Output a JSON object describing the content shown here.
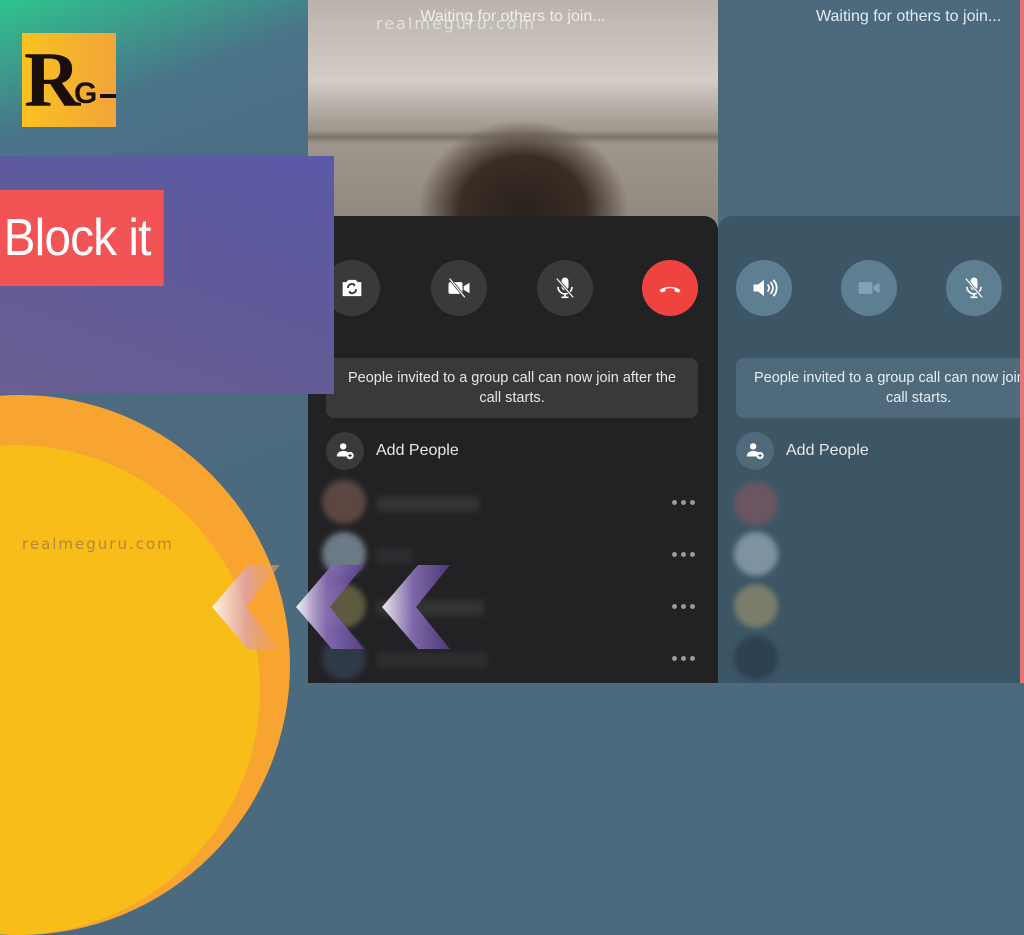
{
  "branding": {
    "logo_letters": {
      "main": "R",
      "sub": "G"
    },
    "watermark": "realmeguru.com",
    "headline": "Block it",
    "colors": {
      "headline_bg": "#f25456",
      "banner": "#5f5a9a",
      "logo_bg": "#f8c21f",
      "circle": "#f7a431"
    }
  },
  "call_screen_dark": {
    "status": "Waiting for others to join...",
    "controls": [
      {
        "id": "flip-camera",
        "icon": "camera-flip-icon"
      },
      {
        "id": "video-off",
        "icon": "video-off-icon"
      },
      {
        "id": "mute",
        "icon": "mic-off-icon"
      },
      {
        "id": "end-call",
        "icon": "phone-hangup-icon",
        "color": "#ef4340"
      }
    ],
    "notice": "People invited to a group call can now join after the call starts.",
    "add_people_label": "Add People",
    "participants": [
      {
        "avatar_color": "#5b4642",
        "more": "more-icon"
      },
      {
        "avatar_color": "#6c7a86",
        "more": "more-icon"
      },
      {
        "avatar_color": "#5d5a40",
        "more": "more-icon"
      },
      {
        "avatar_color": "#2f3a48",
        "more": "more-icon"
      }
    ]
  },
  "call_screen_light": {
    "status": "Waiting for others to join...",
    "controls": [
      {
        "id": "speaker",
        "icon": "speaker-icon"
      },
      {
        "id": "video",
        "icon": "video-icon"
      },
      {
        "id": "mute",
        "icon": "mic-off-icon"
      }
    ],
    "notice_line1": "People invited to a group call can now join after the",
    "notice_line2": "call starts.",
    "add_people_label": "Add People",
    "participants": [
      {
        "avatar_color": "#6a5660"
      },
      {
        "avatar_color": "#7d93a0"
      },
      {
        "avatar_color": "#7b7d6a"
      },
      {
        "avatar_color": "#2c4050"
      }
    ]
  }
}
